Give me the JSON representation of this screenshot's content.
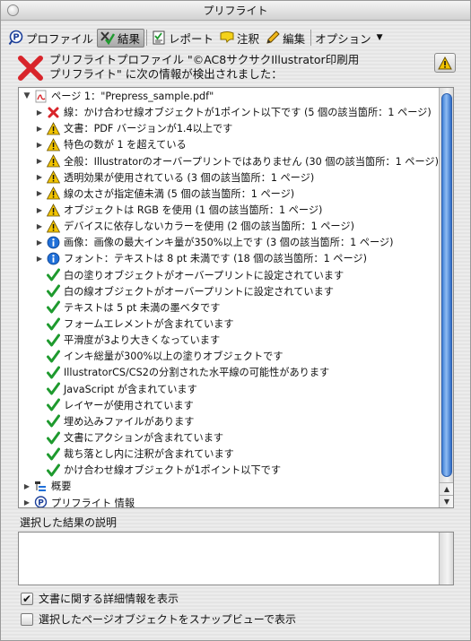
{
  "window": {
    "title": "プリフライト"
  },
  "toolbar": {
    "items": [
      {
        "label": "プロファイル",
        "icon": "profile-icon",
        "active": false
      },
      {
        "label": "結果",
        "icon": "results-icon",
        "active": true
      },
      {
        "label": "レポート",
        "icon": "report-icon",
        "active": false
      },
      {
        "label": "注釈",
        "icon": "annotation-icon",
        "active": false
      },
      {
        "label": "編集",
        "icon": "edit-pencil-icon",
        "active": false
      }
    ],
    "options_label": "オプション"
  },
  "header": {
    "line1": "プリフライトプロファイル \"©AC8サクサクIllustrator印刷用",
    "line2": "プリフライト\" に次の情報が検出されました："
  },
  "tree": {
    "rows": [
      {
        "level": 0,
        "disclosure": "open",
        "icon": "pdf",
        "text": "ページ 1：\"Prepress_sample.pdf\""
      },
      {
        "level": 1,
        "disclosure": "closed",
        "icon": "error",
        "text": "線：かけ合わせ線オブジェクトが1ポイント以下です (5 個の該当箇所：1 ページ)"
      },
      {
        "level": 1,
        "disclosure": "closed",
        "icon": "warning",
        "text": "文書：PDF バージョンが1.4以上です"
      },
      {
        "level": 1,
        "disclosure": "closed",
        "icon": "warning",
        "text": "特色の数が 1 を超えている"
      },
      {
        "level": 1,
        "disclosure": "closed",
        "icon": "warning",
        "text": "全般：Illustratorのオーバープリントではありません (30 個の該当箇所：1 ページ)"
      },
      {
        "level": 1,
        "disclosure": "closed",
        "icon": "warning",
        "text": "透明効果が使用されている (3 個の該当箇所：1 ページ)"
      },
      {
        "level": 1,
        "disclosure": "closed",
        "icon": "warning",
        "text": "線の太さが指定値未満 (5 個の該当箇所：1 ページ)"
      },
      {
        "level": 1,
        "disclosure": "closed",
        "icon": "warning",
        "text": "オブジェクトは RGB を使用 (1 個の該当箇所：1 ページ)"
      },
      {
        "level": 1,
        "disclosure": "closed",
        "icon": "warning",
        "text": "デバイスに依存しないカラーを使用 (2 個の該当箇所：1 ページ)"
      },
      {
        "level": 1,
        "disclosure": "closed",
        "icon": "info",
        "text": "画像：画像の最大インキ量が350%以上です (3 個の該当箇所：1 ページ)"
      },
      {
        "level": 1,
        "disclosure": "closed",
        "icon": "info",
        "text": "フォント：テキストは 8 pt 未満です (18 個の該当箇所：1 ページ)"
      },
      {
        "level": 1,
        "disclosure": "none",
        "icon": "check",
        "text": "白の塗りオブジェクトがオーバープリントに設定されています"
      },
      {
        "level": 1,
        "disclosure": "none",
        "icon": "check",
        "text": "白の線オブジェクトがオーバープリントに設定されています"
      },
      {
        "level": 1,
        "disclosure": "none",
        "icon": "check",
        "text": "テキストは 5 pt 未満の墨ベタです"
      },
      {
        "level": 1,
        "disclosure": "none",
        "icon": "check",
        "text": "フォームエレメントが含まれています"
      },
      {
        "level": 1,
        "disclosure": "none",
        "icon": "check",
        "text": "平滑度が3より大きくなっています"
      },
      {
        "level": 1,
        "disclosure": "none",
        "icon": "check",
        "text": "インキ総量が300%以上の塗りオブジェクトです"
      },
      {
        "level": 1,
        "disclosure": "none",
        "icon": "check",
        "text": "IllustratorCS/CS2の分割された水平線の可能性があります"
      },
      {
        "level": 1,
        "disclosure": "none",
        "icon": "check",
        "text": "JavaScript が含まれています"
      },
      {
        "level": 1,
        "disclosure": "none",
        "icon": "check",
        "text": "レイヤーが使用されています"
      },
      {
        "level": 1,
        "disclosure": "none",
        "icon": "check",
        "text": "埋め込みファイルがあります"
      },
      {
        "level": 1,
        "disclosure": "none",
        "icon": "check",
        "text": "文書にアクションが含まれています"
      },
      {
        "level": 1,
        "disclosure": "none",
        "icon": "check",
        "text": "裁ち落とし内に注釈が含まれています"
      },
      {
        "level": 1,
        "disclosure": "none",
        "icon": "check",
        "text": "かけ合わせ線オブジェクトが1ポイント以下です"
      },
      {
        "level": 0,
        "disclosure": "closed",
        "icon": "overview",
        "text": "概要"
      },
      {
        "level": 0,
        "disclosure": "closed",
        "icon": "preflight-info",
        "text": "プリフライト 情報"
      }
    ]
  },
  "description": {
    "label": "選択した結果の説明",
    "text": ""
  },
  "options": [
    {
      "label": "文書に関する詳細情報を表示",
      "checked": true
    },
    {
      "label": "選択したページオブジェクトをスナップビューで表示",
      "checked": false
    }
  ],
  "colors": {
    "error": "#d8242a",
    "warning": "#f2c400",
    "info": "#1f6fd8",
    "check": "#1e9a2e",
    "scroll": "#3f7fd6"
  }
}
